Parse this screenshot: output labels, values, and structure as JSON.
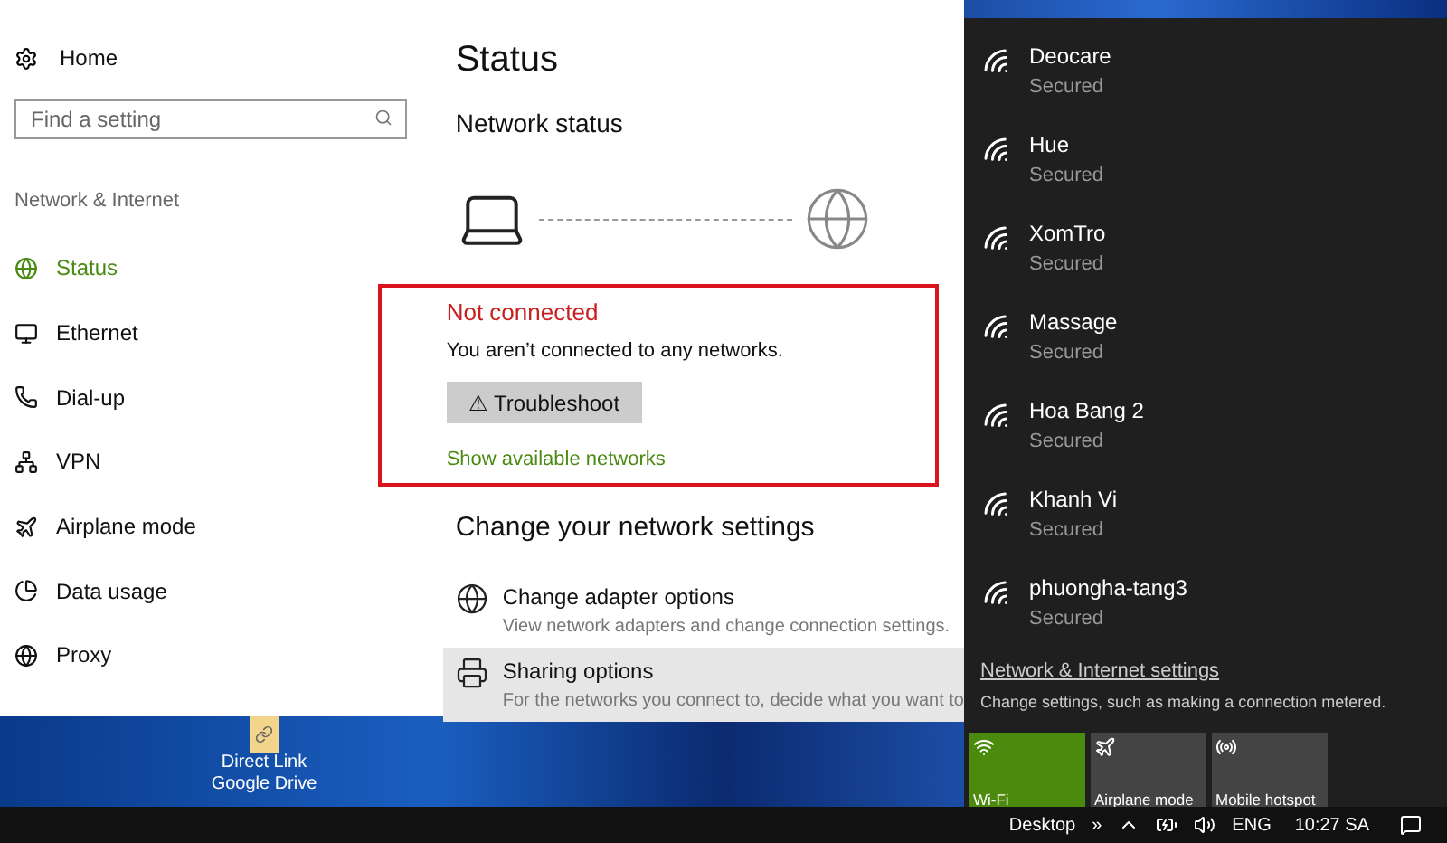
{
  "settings_window": {
    "sidebar": {
      "home": "Home",
      "search": {
        "placeholder": "Find a setting"
      },
      "section": "Network & Internet",
      "items": [
        {
          "label": "Status",
          "selected": true
        },
        {
          "label": "Ethernet",
          "selected": false
        },
        {
          "label": "Dial-up",
          "selected": false
        },
        {
          "label": "VPN",
          "selected": false
        },
        {
          "label": "Airplane mode",
          "selected": false
        },
        {
          "label": "Data usage",
          "selected": false
        },
        {
          "label": "Proxy",
          "selected": false
        }
      ]
    },
    "content": {
      "title": "Status",
      "network_status": "Network status",
      "connected": false,
      "status_title": "Not connected",
      "status_text": "You aren’t connected to any networks.",
      "troubleshoot": "⚠ Troubleshoot",
      "show_networks": "Show available networks",
      "change_heading": "Change your network settings",
      "options": [
        {
          "title": "Change adapter options",
          "description": "View network adapters and change connection settings.",
          "highlighted": false
        },
        {
          "title": "Sharing options",
          "description": "For the networks you connect to, decide what you want to",
          "highlighted": true
        }
      ]
    }
  },
  "desktop_icons": [
    {
      "label": "Direct Link Google Drive"
    }
  ],
  "network_flyout": {
    "networks": [
      {
        "name": "Deocare",
        "status": "Secured"
      },
      {
        "name": "Hue",
        "status": "Secured"
      },
      {
        "name": "XomTro",
        "status": "Secured"
      },
      {
        "name": "Massage",
        "status": "Secured"
      },
      {
        "name": "Hoa Bang 2",
        "status": "Secured"
      },
      {
        "name": "Khanh Vi",
        "status": "Secured"
      },
      {
        "name": "phuongha-tang3",
        "status": "Secured"
      }
    ],
    "settings_link": "Network & Internet settings",
    "settings_text": "Change settings, such as making a connection metered.",
    "tiles": [
      {
        "label": "Wi-Fi",
        "on": true
      },
      {
        "label": "Airplane mode",
        "on": false
      },
      {
        "label": "Mobile hotspot",
        "on": false
      }
    ]
  },
  "taskbar": {
    "toolbar": "Desktop",
    "overflow": "»",
    "language": "ENG",
    "time": "10:27 SA"
  }
}
